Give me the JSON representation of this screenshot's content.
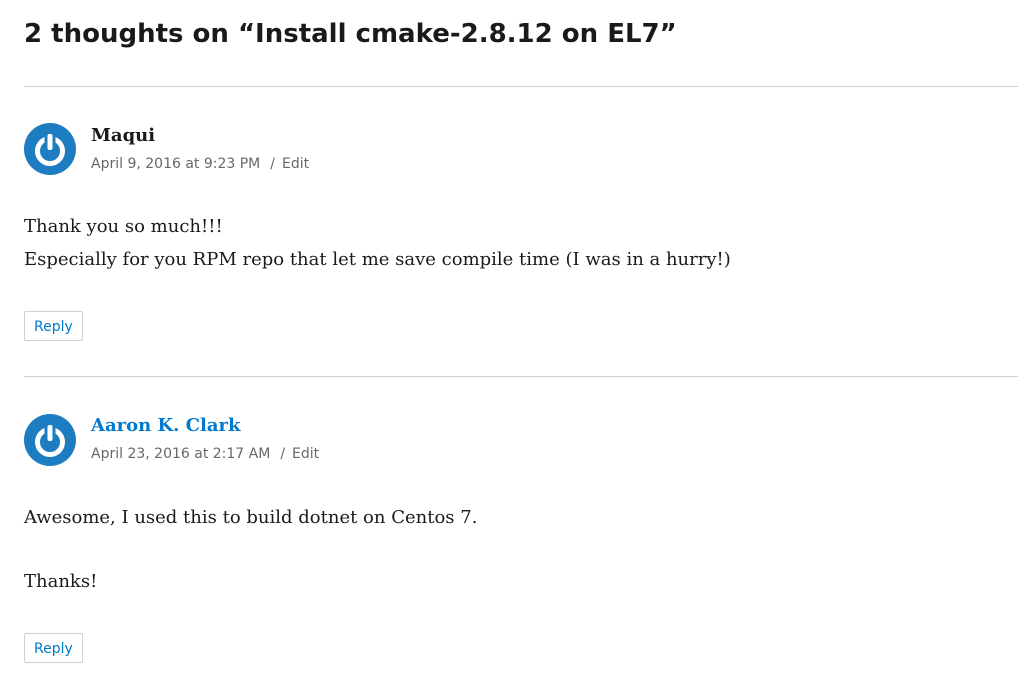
{
  "page": {
    "title": "2 thoughts on “Install cmake-2.8.12 on EL7”"
  },
  "colors": {
    "link": "#007acc",
    "meta": "#686868",
    "divider": "#d1d1d1",
    "avatar": "#1e7cc0"
  },
  "comments": [
    {
      "author": "Maqui",
      "author_is_link": false,
      "date": "April 9, 2016 at 9:23 PM",
      "separator": "/",
      "edit_label": "Edit",
      "body": [
        "Thank you so much!!!",
        "Especially for you RPM repo that let me save compile time (I was in a hurry!)"
      ],
      "reply_label": "Reply",
      "avatar_icon": "power-button-avatar-icon"
    },
    {
      "author": "Aaron K. Clark",
      "author_is_link": true,
      "date": "April 23, 2016 at 2:17 AM",
      "separator": "/",
      "edit_label": "Edit",
      "body": [
        "Awesome, I used this to build dotnet on Centos 7.",
        "Thanks!"
      ],
      "reply_label": "Reply",
      "avatar_icon": "power-button-avatar-icon"
    }
  ]
}
